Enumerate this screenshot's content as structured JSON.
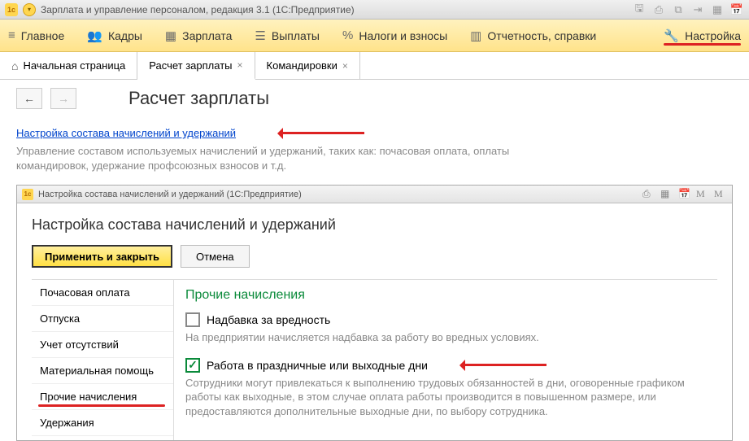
{
  "titlebar": {
    "app_title": "Зарплата и управление персоналом, редакция 3.1  (1С:Предприятие)"
  },
  "toolbar": {
    "items": [
      {
        "label": "Главное"
      },
      {
        "label": "Кадры"
      },
      {
        "label": "Зарплата"
      },
      {
        "label": "Выплаты"
      },
      {
        "label": "Налоги и взносы"
      },
      {
        "label": "Отчетность, справки"
      }
    ],
    "right_label": "Настройка"
  },
  "tabs": {
    "home": "Начальная страница",
    "active": "Расчет зарплаты",
    "other": "Командировки"
  },
  "page": {
    "title": "Расчет зарплаты",
    "link": "Настройка состава начислений и удержаний",
    "desc": "Управление составом используемых начислений и удержаний, таких как: почасовая оплата, оплаты командировок, удержание профсоюзных взносов и т.д."
  },
  "inner": {
    "title": "Настройка состава начислений и удержаний  (1С:Предприятие)",
    "h1": "Настройка состава начислений и удержаний",
    "apply": "Применить и закрыть",
    "cancel": "Отмена",
    "side": [
      "Почасовая оплата",
      "Отпуска",
      "Учет отсутствий",
      "Материальная помощь",
      "Прочие начисления",
      "Удержания"
    ],
    "main": {
      "h2": "Прочие начисления",
      "chk1_label": "Надбавка за вредность",
      "chk1_desc": "На предприятии начисляется надбавка за работу во вредных условиях.",
      "chk2_label": "Работа в праздничные или выходные дни",
      "chk2_desc": "Сотрудники могут привлекаться к выполнению трудовых обязанностей в дни, оговоренные графиком работы как выходные, в этом случае оплата работы производится в повышенном размере, или предоставляются дополнительные выходные дни, по выбору сотрудника."
    }
  }
}
